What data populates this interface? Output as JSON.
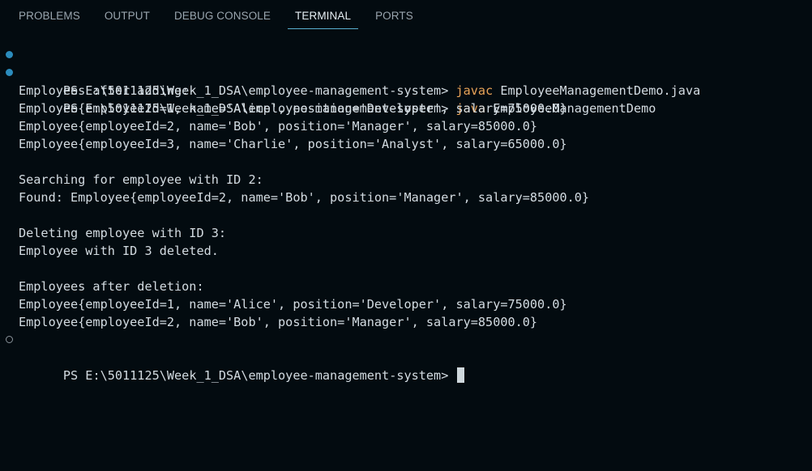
{
  "tabs": [
    {
      "label": "PROBLEMS"
    },
    {
      "label": "OUTPUT"
    },
    {
      "label": "DEBUG CONSOLE"
    },
    {
      "label": "TERMINAL"
    },
    {
      "label": "PORTS"
    }
  ],
  "colors": {
    "background": "#030b10",
    "text": "#d4dce2",
    "command": "#e8a358",
    "success_marker": "#2b8cbd",
    "active_tab_underline": "#5ab0d0"
  },
  "terminal": {
    "prompt": "PS E:\\5011125\\Week_1_DSA\\employee-management-system> ",
    "commands": [
      {
        "name": "javac",
        "args": " EmployeeManagementDemo.java"
      },
      {
        "name": "java",
        "args": " EmployeeManagementDemo"
      }
    ],
    "output": [
      "Employees after adding:",
      "Employee{employeeId=1, name='Alice', position='Developer', salary=75000.0}",
      "Employee{employeeId=2, name='Bob', position='Manager', salary=85000.0}",
      "Employee{employeeId=3, name='Charlie', position='Analyst', salary=65000.0}",
      "",
      "Searching for employee with ID 2:",
      "Found: Employee{employeeId=2, name='Bob', position='Manager', salary=85000.0}",
      "",
      "Deleting employee with ID 3:",
      "Employee with ID 3 deleted.",
      "",
      "Employees after deletion:",
      "Employee{employeeId=1, name='Alice', position='Developer', salary=75000.0}",
      "Employee{employeeId=2, name='Bob', position='Manager', salary=85000.0}"
    ]
  }
}
